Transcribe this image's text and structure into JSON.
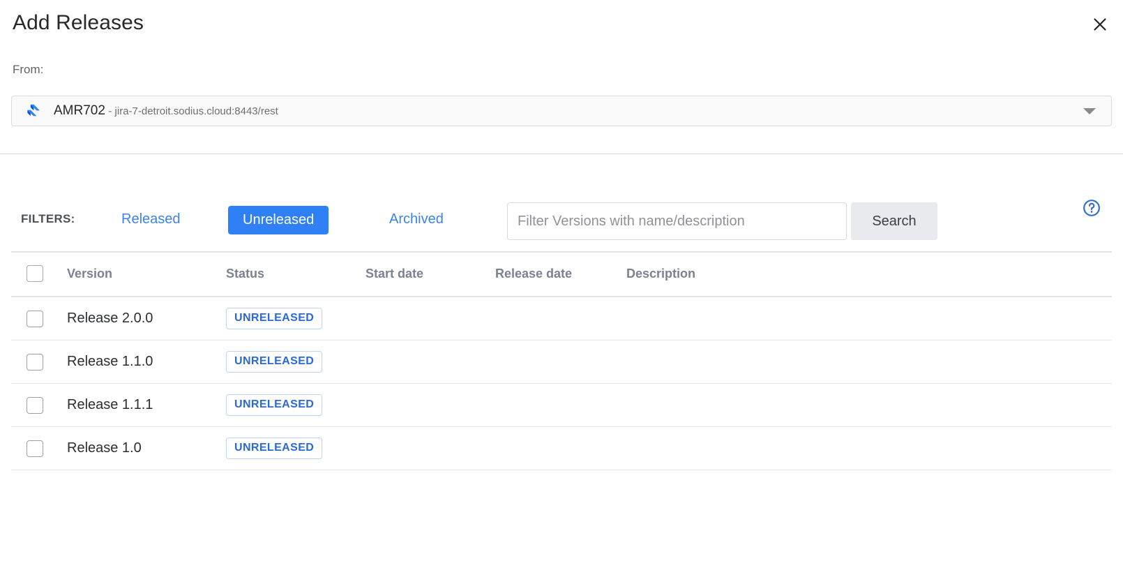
{
  "dialog": {
    "title": "Add Releases",
    "close_icon": "close-icon"
  },
  "source": {
    "label": "From:",
    "icon": "jira-icon",
    "project_key": "AMR702",
    "server_url": "- jira-7-detroit.sodius.cloud:8443/rest",
    "dropdown_icon": "chevron-down-icon"
  },
  "filters": {
    "label": "FILTERS:",
    "options": [
      {
        "label": "Released",
        "active": false
      },
      {
        "label": "Unreleased",
        "active": true
      },
      {
        "label": "Archived",
        "active": false
      }
    ],
    "search_placeholder": "Filter Versions with name/description",
    "search_value": "",
    "search_button": "Search",
    "help_icon": "help-circle-icon"
  },
  "table": {
    "columns": [
      "Version",
      "Status",
      "Start date",
      "Release date",
      "Description"
    ],
    "select_all_checked": false,
    "rows": [
      {
        "checked": false,
        "version": "Release 2.0.0",
        "status": "UNRELEASED",
        "start_date": "",
        "release_date": "",
        "description": ""
      },
      {
        "checked": false,
        "version": "Release 1.1.0",
        "status": "UNRELEASED",
        "start_date": "",
        "release_date": "",
        "description": ""
      },
      {
        "checked": false,
        "version": "Release 1.1.1",
        "status": "UNRELEASED",
        "start_date": "",
        "release_date": "",
        "description": ""
      },
      {
        "checked": false,
        "version": "Release 1.0",
        "status": "UNRELEASED",
        "start_date": "",
        "release_date": "",
        "description": ""
      }
    ]
  },
  "colors": {
    "accent_blue": "#2f80f5",
    "link_blue": "#3b82f0",
    "badge_text": "#2b68d9",
    "badge_border": "#bcd6f7",
    "search_button_bg": "#e8eaed",
    "header_text": "#7a8292"
  }
}
